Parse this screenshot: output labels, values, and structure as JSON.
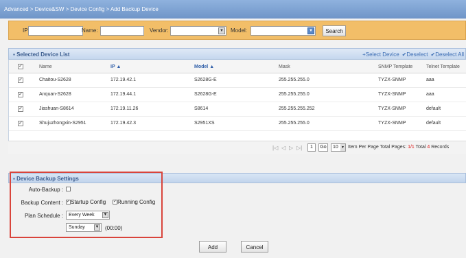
{
  "breadcrumb": "Advanced > Device&SW > Device Config > Add Backup Device",
  "search": {
    "ip_label": "IP:",
    "name_label": "Name:",
    "vendor_label": "Vendor:",
    "model_label": "Model:",
    "button": "Search"
  },
  "selected_panel": {
    "title": "Selected Device List",
    "links": [
      "+Select Device",
      "✔Deselect",
      "✔Deselect All"
    ]
  },
  "table": {
    "headers": [
      "Name",
      "IP",
      "Model",
      "Mask",
      "SNMP Template",
      "Telnet Template"
    ],
    "sort_marks": [
      "",
      "▲",
      "▲",
      "",
      "",
      ""
    ],
    "rows": [
      [
        "Chaitou-S2628",
        "172.19.42.1",
        "S2628G-E",
        "255.255.255.0",
        "TYZX-SNMP",
        "aaa"
      ],
      [
        "Anquan-S2628",
        "172.19.44.1",
        "S2628G-E",
        "255.255.255.0",
        "TYZX-SNMP",
        "aaa"
      ],
      [
        "Jiashuan-S8614",
        "172.19.11.26",
        "S8614",
        "255.255.255.252",
        "TYZX-SNMP",
        "default"
      ],
      [
        "Shujuzhongxin-S2951",
        "172.19.42.3",
        "S2951XS",
        "255.255.255.0",
        "TYZX-SNMP",
        "default"
      ]
    ]
  },
  "pager": {
    "page": "1",
    "go": "Go",
    "per_page": "10",
    "per_page_text": "Item Per Page",
    "total_pages_label": "Total Pages:",
    "total_pages": "1/1",
    "total_label": "Total",
    "total_count": "4",
    "records": "Records"
  },
  "settings": {
    "title": "Device Backup Settings",
    "auto_backup_label": "Auto-Backup :",
    "backup_content_label": "Backup Content :",
    "startup_config": "Startup Config",
    "running_config": "Running Config",
    "plan_schedule_label": "Plan Schedule :",
    "schedule_value": "Every Week",
    "day_value": "Sunday",
    "time_value": "(00:00)"
  },
  "footer": {
    "add": "Add",
    "cancel": "Cancel"
  },
  "colors": {
    "breadcrumb_bg": "#7fa4d6",
    "search_bar_bg": "#f2be68",
    "highlight_box": "#d9443b"
  }
}
